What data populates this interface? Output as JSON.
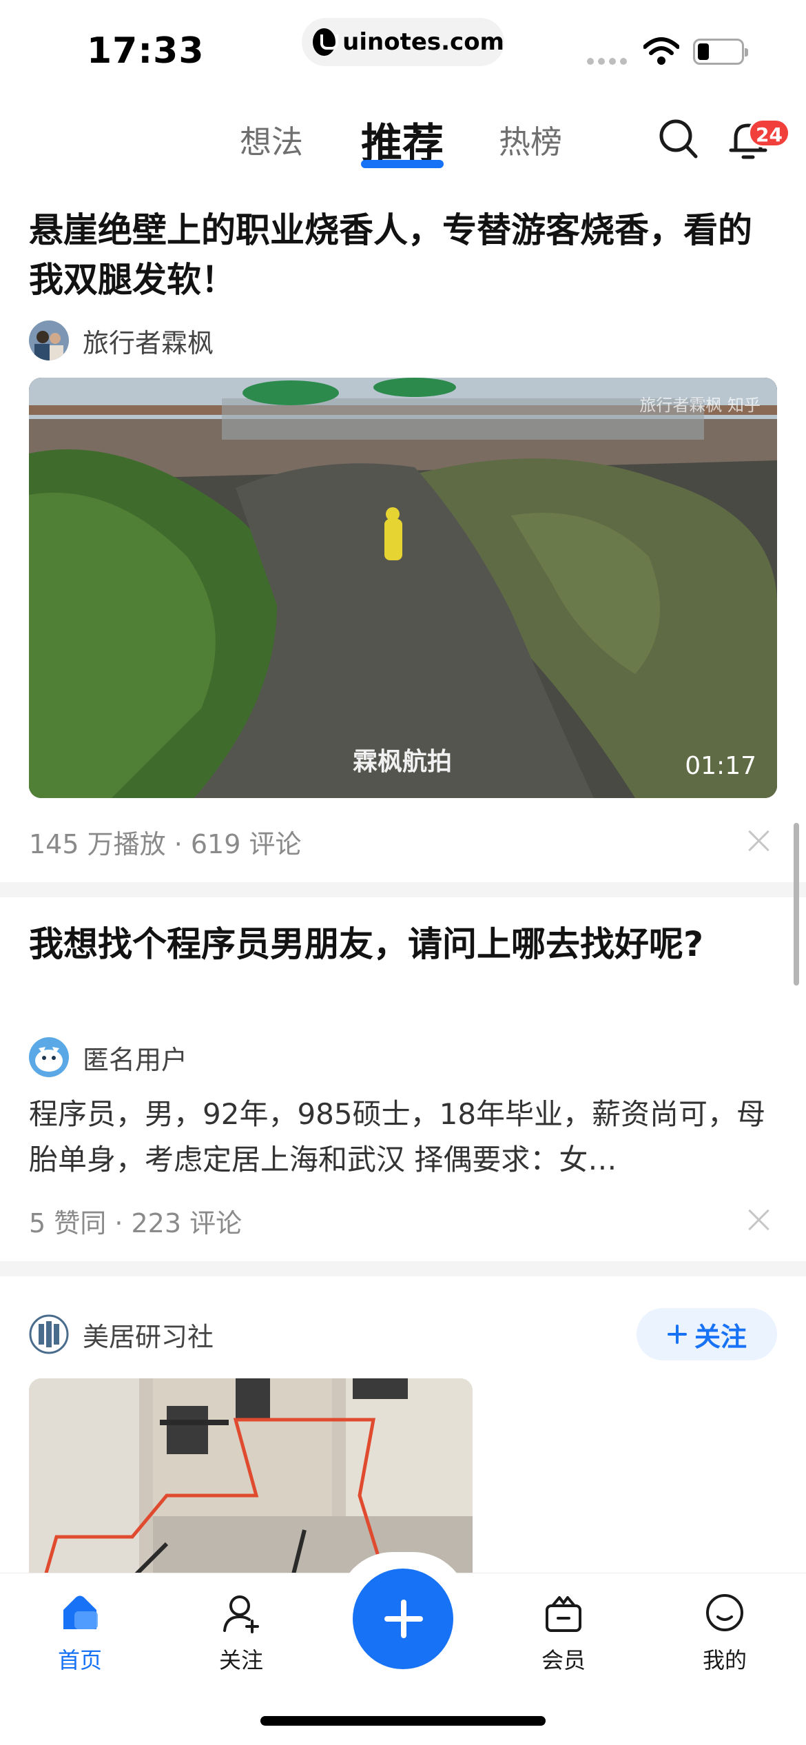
{
  "status_bar": {
    "time": "17:33",
    "url": "uinotes.com"
  },
  "top_nav": {
    "tabs": [
      {
        "label": "想法"
      },
      {
        "label": "推荐",
        "active": true
      },
      {
        "label": "热榜"
      }
    ],
    "notification_count": "24"
  },
  "feed": [
    {
      "title": "悬崖绝壁上的职业烧香人，专替游客烧香，看的我双腿发软！",
      "author": "旅行者霖枫",
      "video": {
        "duration": "01:17",
        "caption": "霖枫航拍",
        "watermark": "旅行者霖枫  知乎"
      },
      "meta": "145 万播放 · 619 评论"
    },
    {
      "title": "我想找个程序员男朋友，请问上哪去找好呢?",
      "author": "匿名用户",
      "excerpt": "程序员，男，92年，985硕士，18年毕业，薪资尚可，母胎单身，考虑定居上海和武汉 择偶要求：女…",
      "meta": "5 赞同 · 223 评论"
    },
    {
      "author": "美居研习社",
      "follow_label": "关注"
    }
  ],
  "bottom_nav": [
    {
      "label": "首页",
      "icon": "home-icon",
      "active": true
    },
    {
      "label": "关注",
      "icon": "follow-user-icon"
    },
    {
      "label": "",
      "icon": "plus-icon"
    },
    {
      "label": "会员",
      "icon": "member-bag-icon"
    },
    {
      "label": "我的",
      "icon": "profile-face-icon"
    }
  ],
  "colors": {
    "accent": "#1772f6",
    "badge": "#f1403c",
    "meta_text": "#8a8a8a",
    "divider": "#f4f4f4"
  }
}
